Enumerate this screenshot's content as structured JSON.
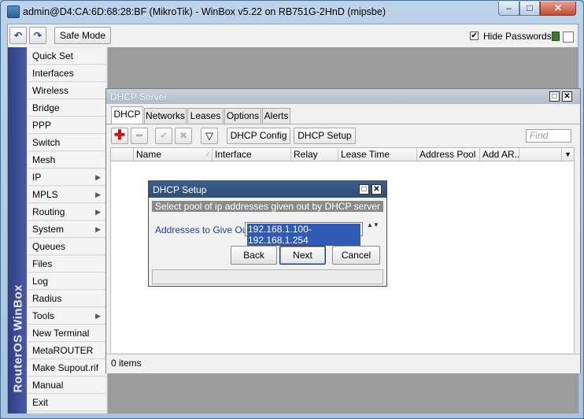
{
  "window": {
    "title": "admin@D4:CA:6D:68:28:BF (MikroTik) - WinBox v5.22 on RB751G-2HnD (mipsbe)",
    "min_glyph": "–",
    "max_glyph": "□",
    "close_glyph": "✕"
  },
  "toolbar": {
    "undo_glyph": "↶",
    "redo_glyph": "↷",
    "safe_mode_label": "Safe Mode",
    "hide_passwords_checked": "✔",
    "hide_passwords_label": "Hide Passwords"
  },
  "sidebar": {
    "brand": "RouterOS WinBox",
    "items": [
      {
        "label": "Quick Set",
        "arrow": ""
      },
      {
        "label": "Interfaces",
        "arrow": ""
      },
      {
        "label": "Wireless",
        "arrow": ""
      },
      {
        "label": "Bridge",
        "arrow": ""
      },
      {
        "label": "PPP",
        "arrow": ""
      },
      {
        "label": "Switch",
        "arrow": ""
      },
      {
        "label": "Mesh",
        "arrow": ""
      },
      {
        "label": "IP",
        "arrow": "▶"
      },
      {
        "label": "MPLS",
        "arrow": "▶"
      },
      {
        "label": "Routing",
        "arrow": "▶"
      },
      {
        "label": "System",
        "arrow": "▶"
      },
      {
        "label": "Queues",
        "arrow": ""
      },
      {
        "label": "Files",
        "arrow": ""
      },
      {
        "label": "Log",
        "arrow": ""
      },
      {
        "label": "Radius",
        "arrow": ""
      },
      {
        "label": "Tools",
        "arrow": "▶"
      },
      {
        "label": "New Terminal",
        "arrow": ""
      },
      {
        "label": "MetaROUTER",
        "arrow": ""
      },
      {
        "label": "Make Supout.rif",
        "arrow": ""
      },
      {
        "label": "Manual",
        "arrow": ""
      },
      {
        "label": "Exit",
        "arrow": ""
      }
    ]
  },
  "dhcp_server": {
    "title": "DHCP Server",
    "max_glyph": "□",
    "close_glyph": "✕",
    "tabs": [
      "DHCP",
      "Networks",
      "Leases",
      "Options",
      "Alerts"
    ],
    "active_tab": "DHCP",
    "add_glyph": "✚",
    "remove_glyph": "━",
    "enable_glyph": "✔",
    "disable_glyph": "✖",
    "filter_glyph": "▽",
    "config_label": "DHCP Config",
    "setup_label": "DHCP Setup",
    "find_placeholder": "Find",
    "columns": [
      "Name",
      "Interface",
      "Relay",
      "Lease Time",
      "Address Pool",
      "Add AR..."
    ],
    "sort_glyph": "∕",
    "menu_glyph": "▼",
    "status": "0 items"
  },
  "dhcp_setup": {
    "title": "DHCP Setup",
    "max_glyph": "□",
    "close_glyph": "✕",
    "description": "Select pool of ip addresses given out by DHCP server",
    "field_label": "Addresses to Give Out:",
    "field_value": "192.168.1.100-192.168.1.254",
    "stepper_glyph": "▲▼",
    "back_label": "Back",
    "next_label": "Next",
    "cancel_label": "Cancel"
  }
}
